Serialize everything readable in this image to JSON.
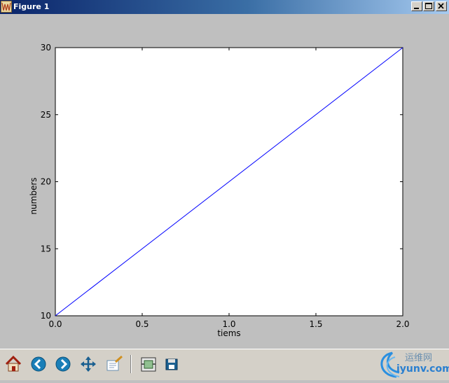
{
  "window": {
    "title": "Figure 1",
    "controls": [
      "minimize-icon",
      "maximize-icon",
      "close-icon"
    ]
  },
  "toolbar": {
    "buttons": [
      {
        "name": "home",
        "icon": "home-icon"
      },
      {
        "name": "back",
        "icon": "back-arrow-icon"
      },
      {
        "name": "forward",
        "icon": "forward-arrow-icon"
      },
      {
        "name": "pan",
        "icon": "move-icon"
      },
      {
        "name": "zoom",
        "icon": "zoom-rect-icon"
      },
      {
        "name": "subplots",
        "icon": "subplots-icon"
      },
      {
        "name": "save",
        "icon": "floppy-icon"
      }
    ]
  },
  "watermark": {
    "text_cn": "运维网",
    "url": "iyunv.com"
  },
  "chart_data": {
    "type": "line",
    "xlabel": "tiems",
    "ylabel": "numbers",
    "xlim": [
      0.0,
      2.0
    ],
    "ylim": [
      10,
      30
    ],
    "xticks": [
      "0.0",
      "0.5",
      "1.0",
      "1.5",
      "2.0"
    ],
    "yticks": [
      "10",
      "15",
      "20",
      "25",
      "30"
    ],
    "series": [
      {
        "x": [
          0.0,
          2.0
        ],
        "y": [
          10,
          30
        ],
        "color": "#0000ff"
      }
    ],
    "grid": false
  },
  "colors": {
    "figure_bg": "#bfbfbf",
    "plot_bg": "#ffffff",
    "line": "#0000ff"
  }
}
